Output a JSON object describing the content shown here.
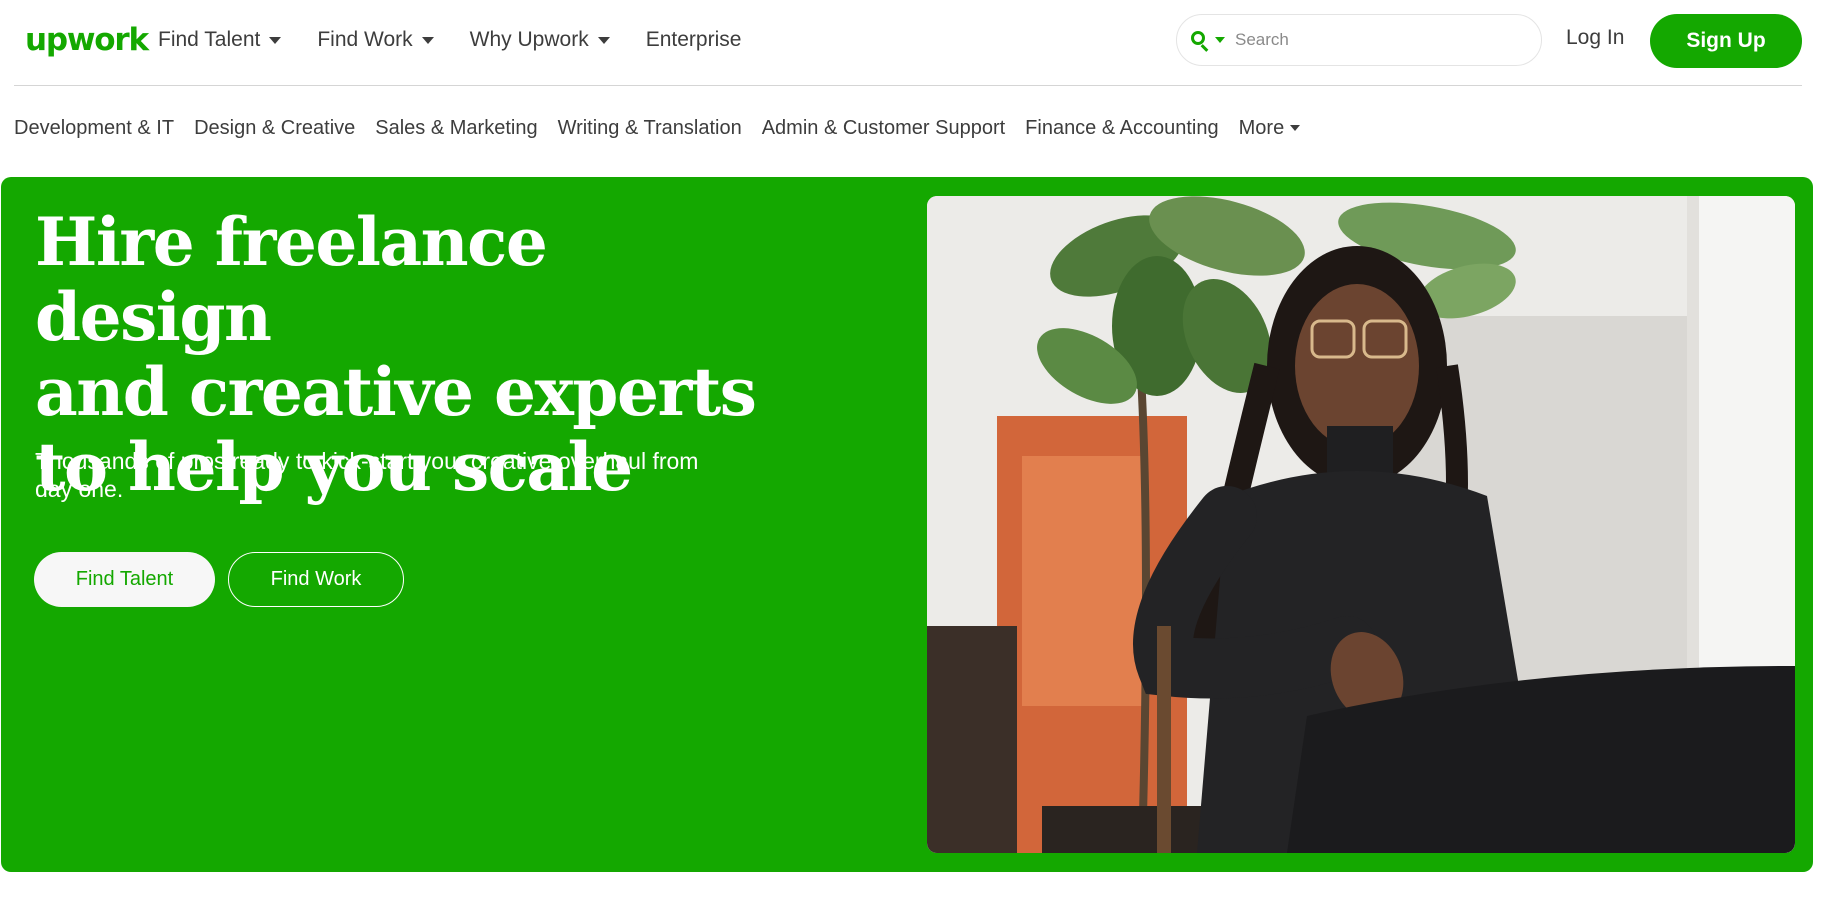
{
  "brand": {
    "logo_text": "upwork",
    "accent": "#14a800",
    "text_dark": "#3d3d3d"
  },
  "header": {
    "nav": [
      {
        "label": "Find Talent",
        "has_dropdown": true
      },
      {
        "label": "Find Work",
        "has_dropdown": true
      },
      {
        "label": "Why Upwork",
        "has_dropdown": true
      },
      {
        "label": "Enterprise",
        "has_dropdown": false
      }
    ],
    "search": {
      "placeholder": "Search",
      "icon": "search-icon"
    },
    "login_label": "Log In",
    "signup_label": "Sign Up"
  },
  "categories": {
    "items": [
      "Development & IT",
      "Design & Creative",
      "Sales & Marketing",
      "Writing & Translation",
      "Admin & Customer Support",
      "Finance & Accounting"
    ],
    "more_label": "More"
  },
  "hero": {
    "title_lines": [
      "Hire freelance design",
      "and creative experts",
      "to help you scale"
    ],
    "subtitle": "Thousands of pros ready to kick-start your creative overhaul from day one.",
    "primary_button": "Find Talent",
    "secondary_button": "Find Work",
    "background": "#14a800"
  }
}
